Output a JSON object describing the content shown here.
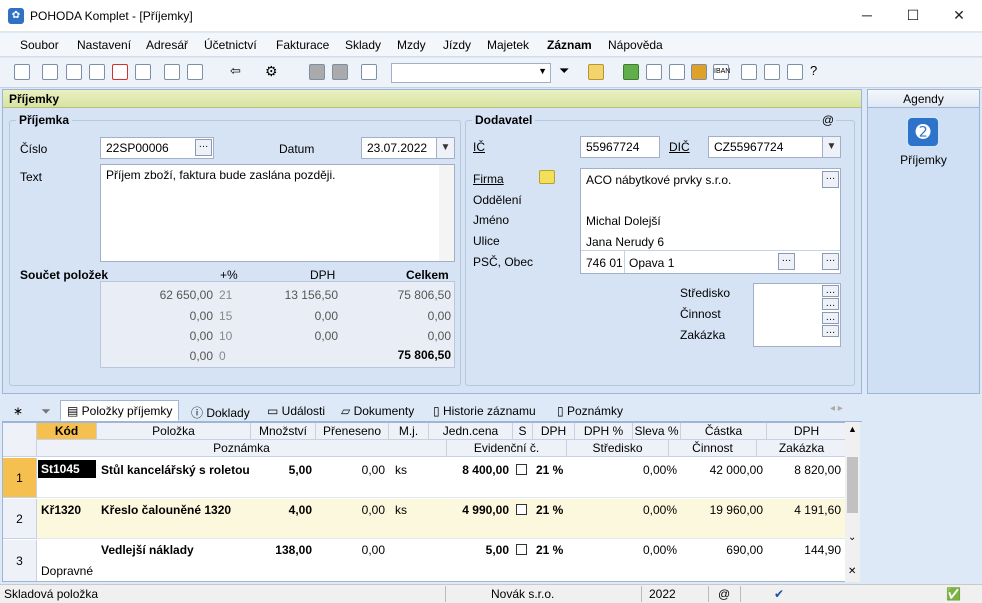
{
  "window": {
    "title": "POHODA Komplet - [Příjemky]"
  },
  "menu": [
    "Soubor",
    "Nastavení",
    "Adresář",
    "Účetnictví",
    "Fakturace",
    "Sklady",
    "Mzdy",
    "Jízdy",
    "Majetek",
    "Záznam",
    "Nápověda"
  ],
  "pane": {
    "header": "Příjemky"
  },
  "prijemka": {
    "group_title": "Příjemka",
    "cislo_label": "Číslo",
    "cislo": "22SP00006",
    "datum_label": "Datum",
    "datum": "23.07.2022",
    "text_label": "Text",
    "text": "Příjem zboží, faktura bude zaslána později."
  },
  "soucet": {
    "title": "Součet položek",
    "col_pct": "+%",
    "col_dph": "DPH",
    "col_celkem": "Celkem",
    "rows": [
      {
        "base": "62 650,00",
        "pct": "21",
        "dph": "13 156,50",
        "celkem": "75 806,50"
      },
      {
        "base": "0,00",
        "pct": "15",
        "dph": "0,00",
        "celkem": "0,00"
      },
      {
        "base": "0,00",
        "pct": "10",
        "dph": "0,00",
        "celkem": "0,00"
      },
      {
        "base": "0,00",
        "pct": "0",
        "dph": "",
        "celkem": "75 806,50"
      }
    ]
  },
  "dodavatel": {
    "group_title": "Dodavatel",
    "at": "@",
    "ic_label": "IČ",
    "ic": "55967724",
    "dic_label": "DIČ",
    "dic": "CZ55967724",
    "firma_label": "Firma",
    "firma": "ACO nábytkové prvky s.r.o.",
    "oddeleni_label": "Oddělení",
    "oddeleni": "",
    "jmeno_label": "Jméno",
    "jmeno": "Michal Dolejší",
    "ulice_label": "Ulice",
    "ulice": "Jana Nerudy 6",
    "psc_label": "PSČ, Obec",
    "psc": "746 01",
    "obec": "Opava 1",
    "stredisko_label": "Středisko",
    "cinnost_label": "Činnost",
    "zakazka_label": "Zakázka"
  },
  "agendy": {
    "title": "Agendy",
    "item": "Příjemky"
  },
  "tabs": [
    "Položky příjemky",
    "Doklady",
    "Události",
    "Dokumenty",
    "Historie záznamu",
    "Poznámky"
  ],
  "grid": {
    "headers": [
      "Kód",
      "Položka",
      "Množství",
      "Přeneseno",
      "M.j.",
      "Jedn.cena",
      "S",
      "DPH",
      "DPH %",
      "Sleva %",
      "Částka",
      "DPH"
    ],
    "headers2": [
      "Poznámka",
      "Evidenční č.",
      "Středisko",
      "Činnost",
      "Zakázka"
    ],
    "rows": [
      {
        "n": "1",
        "kod": "St1045",
        "polozka": "Stůl kancelářský s roletou",
        "mnozstvi": "5,00",
        "preneseno": "0,00",
        "mj": "ks",
        "cena": "8 400,00",
        "dph": "21 %",
        "sleva": "0,00%",
        "castka": "42 000,00",
        "dphv": "8 820,00",
        "poznamka": ""
      },
      {
        "n": "2",
        "kod": "Kř1320",
        "polozka": "Křeslo čalouněné 1320",
        "mnozstvi": "4,00",
        "preneseno": "0,00",
        "mj": "ks",
        "cena": "4 990,00",
        "dph": "21 %",
        "sleva": "0,00%",
        "castka": "19 960,00",
        "dphv": "4 191,60",
        "poznamka": ""
      },
      {
        "n": "3",
        "kod": "",
        "polozka": "Vedlejší náklady",
        "mnozstvi": "138,00",
        "preneseno": "0,00",
        "mj": "",
        "cena": "5,00",
        "dph": "21 %",
        "sleva": "0,00%",
        "castka": "690,00",
        "dphv": "144,90",
        "poznamka": "Dopravné"
      }
    ]
  },
  "status": {
    "left": "Skladová položka",
    "company": "Novák s.r.o.",
    "year": "2022",
    "at": "@"
  }
}
